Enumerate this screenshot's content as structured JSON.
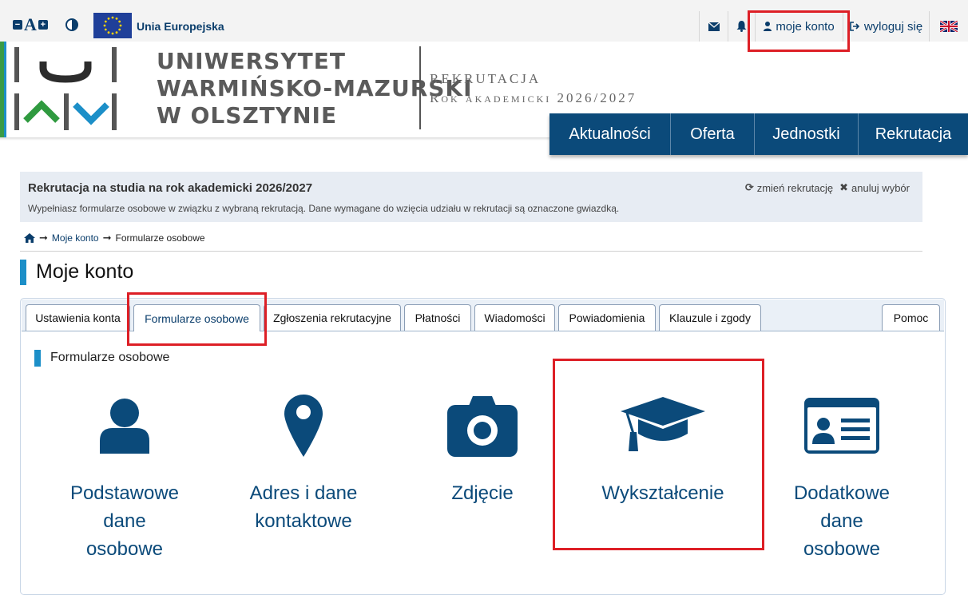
{
  "topbar": {
    "eu_label": "Unia Europejska",
    "account_label": "moje konto",
    "logout_label": "wyloguj się",
    "accessibility": [
      "decrease-font-icon",
      "font-size-icon",
      "increase-font-icon",
      "contrast-icon"
    ]
  },
  "header": {
    "university_line1": "UNIWERSYTET",
    "university_line2": "WARMIŃSKO-MAZURSKI",
    "university_line3": "W OLSZTYNIE",
    "recruitment_line1": "REKRUTACJA",
    "recruitment_line2": "Rok akademicki 2026/2027"
  },
  "nav": {
    "items": [
      "Aktualności",
      "Oferta",
      "Jednostki",
      "Rekrutacja"
    ]
  },
  "info": {
    "title": "Rekrutacja na studia na rok akademicki 2026/2027",
    "description": "Wypełniasz formularze osobowe w związku z wybraną rekrutacją. Dane wymagane do wzięcia udziału w rekrutacji są oznaczone gwiazdką.",
    "change_label": "zmień rekrutację",
    "cancel_label": "anuluj wybór"
  },
  "breadcrumb": {
    "account": "Moje konto",
    "current": "Formularze osobowe"
  },
  "page": {
    "title": "Moje konto"
  },
  "tabs": {
    "items": [
      "Ustawienia konta",
      "Formularze osobowe",
      "Zgłoszenia rekrutacyjne",
      "Płatności",
      "Wiadomości",
      "Powiadomienia",
      "Klauzule i zgody"
    ],
    "active": "Formularze osobowe",
    "help": "Pomoc"
  },
  "section": {
    "title": "Formularze osobowe",
    "cards": [
      {
        "icon": "user-icon",
        "label": "Podstawowe dane osobowe"
      },
      {
        "icon": "map-marker-icon",
        "label": "Adres i dane kontaktowe"
      },
      {
        "icon": "camera-icon",
        "label": "Zdjęcie"
      },
      {
        "icon": "graduation-cap-icon",
        "label": "Wykształcenie"
      },
      {
        "icon": "id-card-icon",
        "label": "Dodatkowe dane osobowe"
      }
    ]
  },
  "colors": {
    "primary": "#0b4a7a",
    "accent": "#1c8fc8",
    "highlight": "#dd1f26",
    "green": "#3a9b45"
  }
}
